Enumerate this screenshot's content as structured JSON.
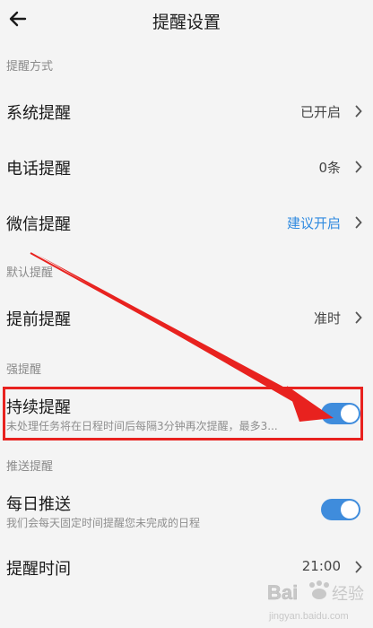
{
  "header": {
    "title": "提醒设置",
    "back_icon": "arrow-left-icon"
  },
  "sections": {
    "reminder_method": "提醒方式",
    "default_reminder": "默认提醒",
    "strong_reminder": "强提醒",
    "push_reminder": "推送提醒"
  },
  "rows": {
    "system": {
      "label": "系统提醒",
      "value": "已开启"
    },
    "phone": {
      "label": "电话提醒",
      "value": "0条"
    },
    "wechat": {
      "label": "微信提醒",
      "value": "建议开启"
    },
    "advance": {
      "label": "提前提醒",
      "value": "准时"
    },
    "continuous": {
      "label": "持续提醒",
      "sub": "未处理任务将在日程时间后每隔3分钟再次提醒，最多3...",
      "enabled": true
    },
    "daily_push": {
      "label": "每日推送",
      "sub": "我们会每天固定时间提醒您未完成的日程",
      "enabled": true
    },
    "reminder_time": {
      "label": "提醒时间",
      "value": "21:00"
    }
  },
  "colors": {
    "accent": "#3f8cdc",
    "link": "#2f8ae0",
    "annotation": "#e8221f"
  },
  "watermark": {
    "brand": "Bai",
    "suffix": "经验",
    "url": "jingyan.baidu.com"
  }
}
